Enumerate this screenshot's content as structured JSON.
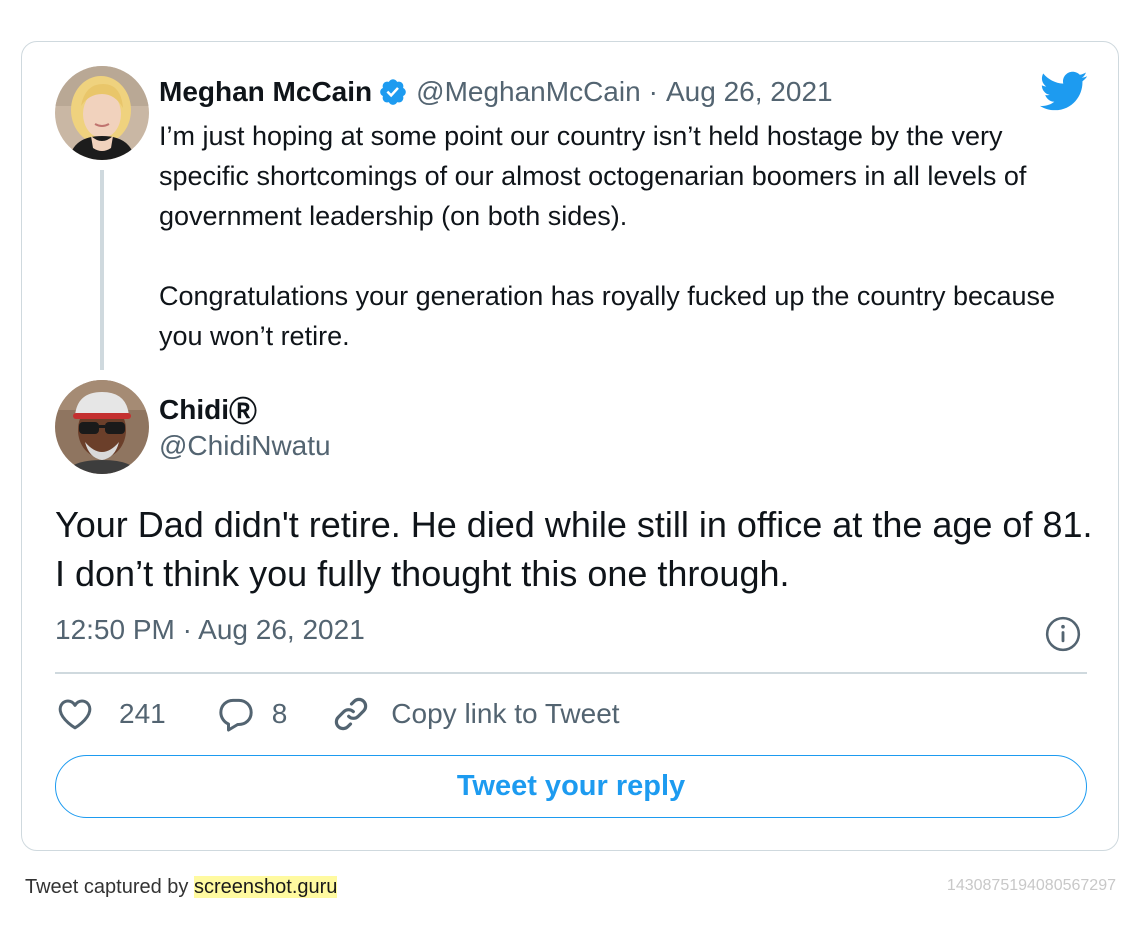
{
  "quoted_tweet": {
    "author_name": "Meghan McCain",
    "handle": "@MeghanMcCain",
    "separator": "·",
    "date": "Aug 26, 2021",
    "paragraphs": [
      "I’m just hoping at some point our country isn’t held hostage by the very specific shortcomings of our almost octogenarian boomers in all levels of government leadership (on both sides).",
      "Congratulations your generation has royally fucked up the country because you won’t retire."
    ]
  },
  "main_tweet": {
    "author_name": "Chidi",
    "name_badge": "Ⓡ",
    "handle": "@ChidiNwatu",
    "text": "Your Dad didn't retire. He died while still in office at the age of 81. I don’t think you fully thought this one through.",
    "timestamp": "12:50 PM · Aug 26, 2021"
  },
  "actions": {
    "like_count": "241",
    "reply_count": "8",
    "copy_link_label": "Copy link to Tweet"
  },
  "reply_button_label": "Tweet your reply",
  "footer": {
    "captured_by": "Tweet captured by ",
    "site": "screenshot.guru",
    "tweet_id": "1430875194080567297"
  },
  "icons": {
    "brand_logo": "twitter-bird-icon",
    "verified": "verified-badge-icon",
    "info": "info-icon",
    "like": "heart-icon",
    "reply": "comment-icon",
    "copy": "link-icon"
  },
  "colors": {
    "accent": "#1d9bf0",
    "text": "#0f1419",
    "secondary_text": "#536471",
    "border": "#cfd9de",
    "footer_highlight": "#fffaa0"
  }
}
